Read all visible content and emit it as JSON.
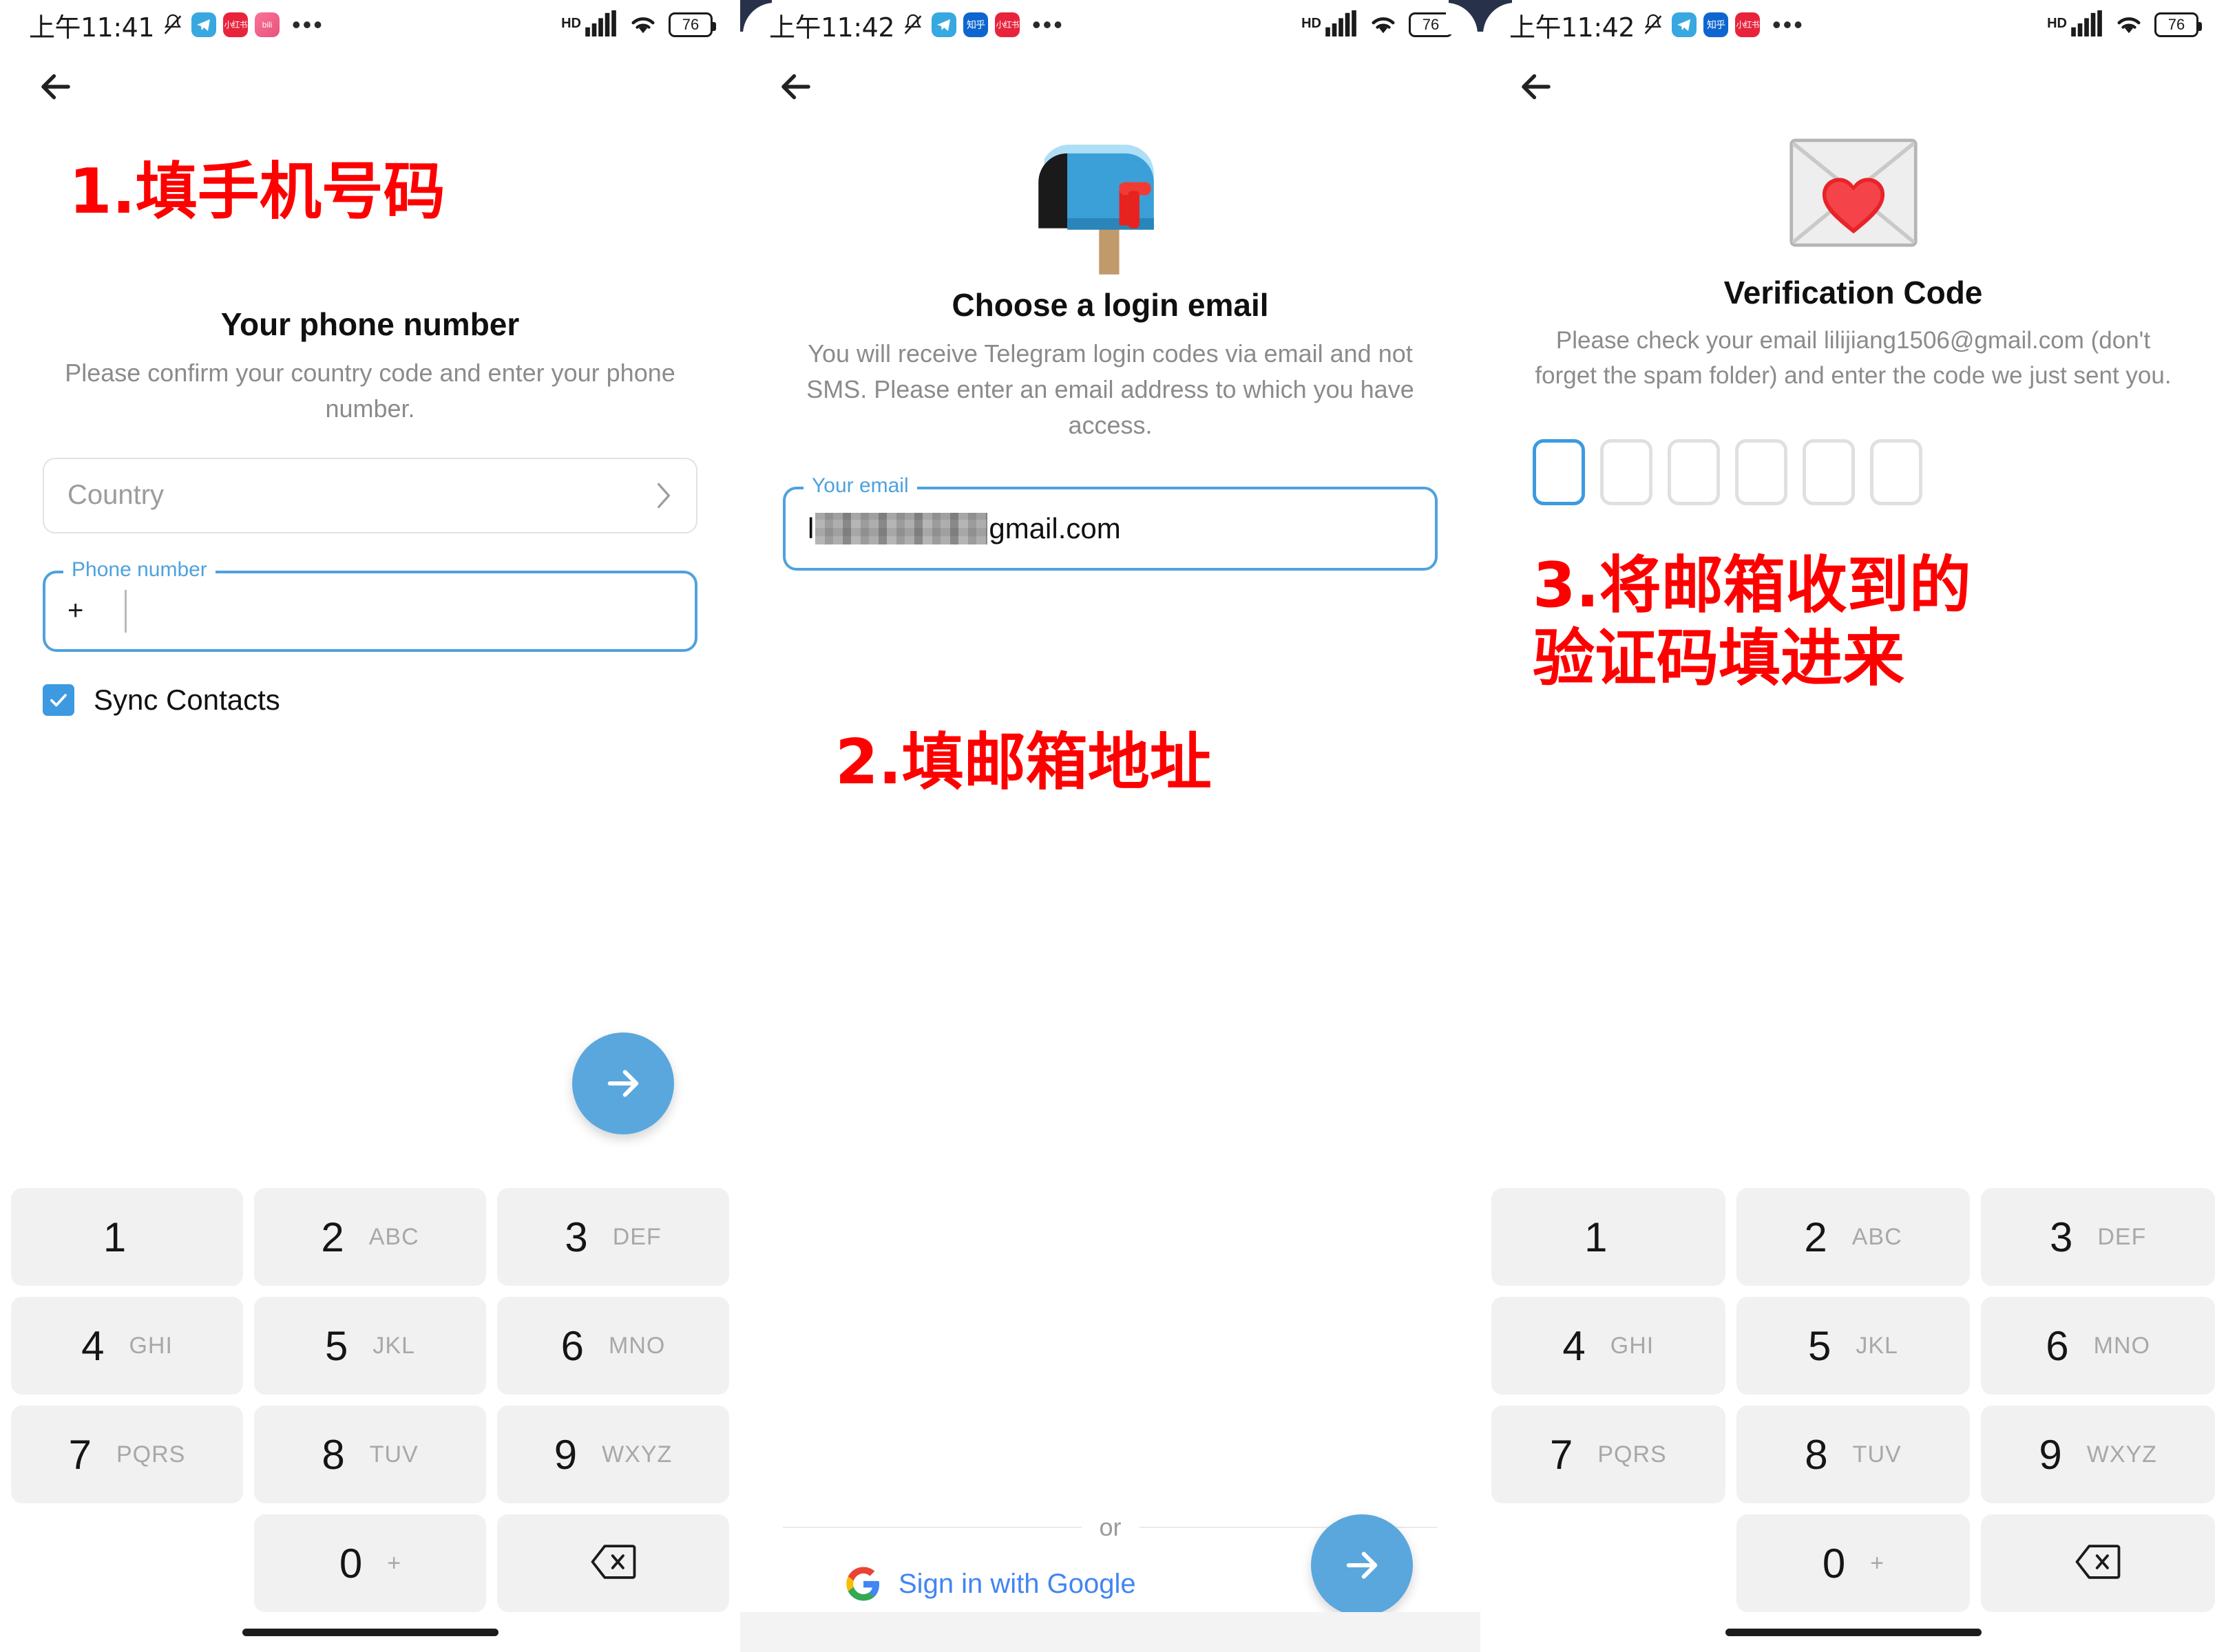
{
  "panels": [
    {
      "status": {
        "time": "上午11:41",
        "battery": "76",
        "hd": "HD",
        "dots": "•••",
        "apps": [
          "telegram",
          "xiaohongshu",
          "bilibili"
        ]
      },
      "annotation": "1.填手机号码",
      "title": "Your phone number",
      "subtitle": "Please confirm your country code\nand enter your phone number.",
      "country_placeholder": "Country",
      "phone_label": "Phone number",
      "phone_prefix": "+",
      "phone_value": "",
      "sync_label": "Sync Contacts",
      "sync_checked": true,
      "keypad": [
        {
          "num": "1",
          "letters": ""
        },
        {
          "num": "2",
          "letters": "ABC"
        },
        {
          "num": "3",
          "letters": "DEF"
        },
        {
          "num": "4",
          "letters": "GHI"
        },
        {
          "num": "5",
          "letters": "JKL"
        },
        {
          "num": "6",
          "letters": "MNO"
        },
        {
          "num": "7",
          "letters": "PQRS"
        },
        {
          "num": "8",
          "letters": "TUV"
        },
        {
          "num": "9",
          "letters": "WXYZ"
        },
        {
          "num": "0",
          "letters": "+"
        }
      ]
    },
    {
      "status": {
        "time": "上午11:42",
        "battery": "76",
        "hd": "HD",
        "dots": "•••",
        "apps": [
          "telegram",
          "zhihu",
          "xiaohongshu"
        ]
      },
      "annotation": "2.填邮箱地址",
      "title": "Choose a login email",
      "subtitle": "You will receive Telegram login codes via\nemail and not SMS. Please enter an email\naddress to which you have access.",
      "email_label": "Your email",
      "email_prefix": "l",
      "email_suffix": "gmail.com",
      "or_text": "or",
      "google_text": "Sign in with Google"
    },
    {
      "status": {
        "time": "上午11:42",
        "battery": "76",
        "hd": "HD",
        "dots": "•••",
        "apps": [
          "telegram",
          "zhihu",
          "xiaohongshu"
        ]
      },
      "annotation": "3.将邮箱收到的\n验证码填进来",
      "title": "Verification Code",
      "subtitle": "Please check your email lilijiang1506@gmail.com\n(don't forget the spam folder) and enter the\ncode we just sent you.",
      "email_address": "lilijiang1506@gmail.com",
      "code_boxes": 6,
      "code_active_index": 0,
      "keypad": [
        {
          "num": "1",
          "letters": ""
        },
        {
          "num": "2",
          "letters": "ABC"
        },
        {
          "num": "3",
          "letters": "DEF"
        },
        {
          "num": "4",
          "letters": "GHI"
        },
        {
          "num": "5",
          "letters": "JKL"
        },
        {
          "num": "6",
          "letters": "MNO"
        },
        {
          "num": "7",
          "letters": "PQRS"
        },
        {
          "num": "8",
          "letters": "TUV"
        },
        {
          "num": "9",
          "letters": "WXYZ"
        },
        {
          "num": "0",
          "letters": "+"
        }
      ]
    }
  ],
  "colors": {
    "accent": "#4ea2dd",
    "fab": "#5aa7dd",
    "annotation": "#fe0000",
    "key_bg": "#f1f1f1",
    "google_blue": "#4285f4"
  }
}
